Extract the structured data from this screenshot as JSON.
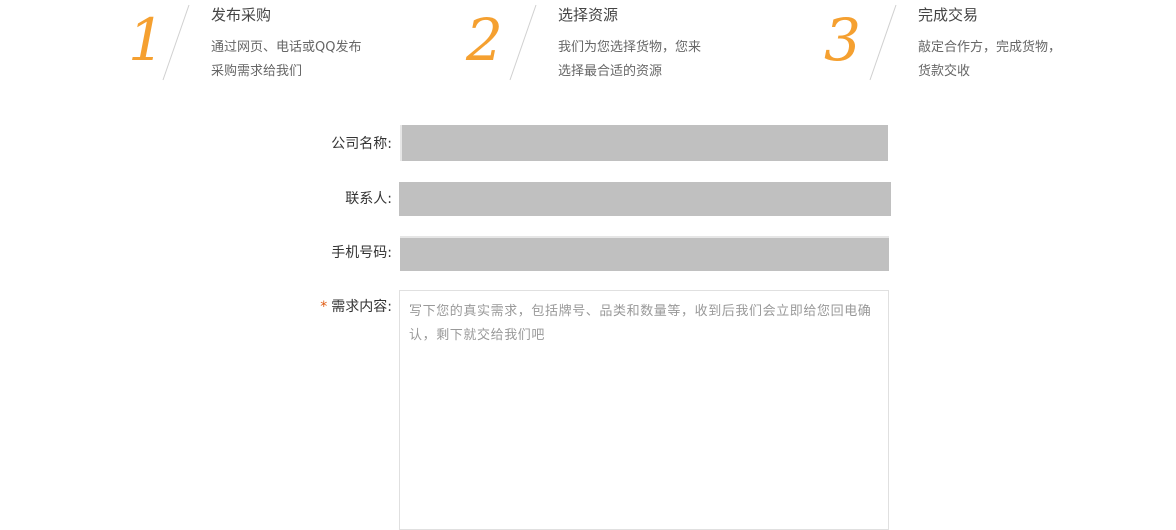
{
  "steps": [
    {
      "number": "1",
      "title": "发布采购",
      "desc_line1": "通过网页、电话或QQ发布",
      "desc_line2": "采购需求给我们"
    },
    {
      "number": "2",
      "title": "选择资源",
      "desc_line1": "我们为您选择货物，您来",
      "desc_line2": "选择最合适的资源"
    },
    {
      "number": "3",
      "title": "完成交易",
      "desc_line1": "敲定合作方，完成货物，",
      "desc_line2": "货款交收"
    }
  ],
  "form": {
    "company_label": "公司名称:",
    "company_value": "",
    "contact_label": "联系人:",
    "contact_value": "",
    "phone_label": "手机号码:",
    "phone_value": "",
    "required_mark": "*",
    "demand_label": "需求内容:",
    "demand_placeholder": "写下您的真实需求，包括牌号、品类和数量等，收到后我们会立即给您回电确认，剩下就交给我们吧"
  },
  "colors": {
    "accent": "#f5a030",
    "input_fill": "#c0c0c0",
    "required": "#e05a10"
  }
}
